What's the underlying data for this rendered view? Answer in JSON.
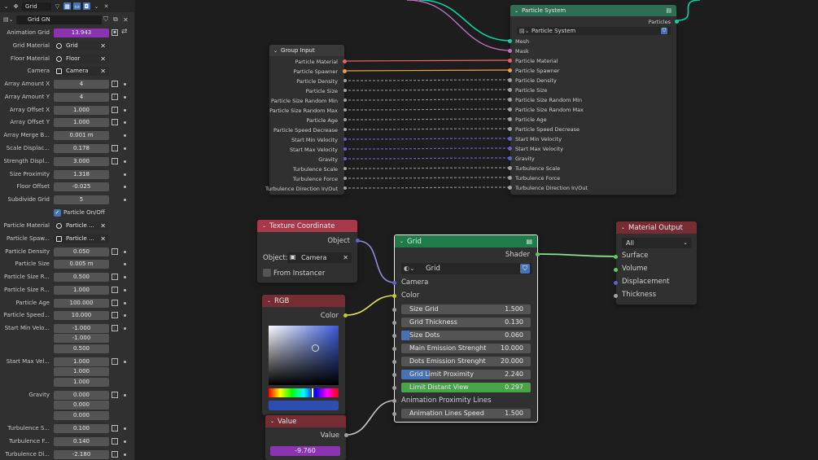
{
  "header": {
    "title": "Grid"
  },
  "modifier": {
    "name": "Grid GN"
  },
  "properties": [
    {
      "label": "Animation Grid",
      "value": "13.943",
      "kind": "purple",
      "key": "anim"
    },
    {
      "label": "Grid Material",
      "value": "Grid",
      "kind": "mat"
    },
    {
      "label": "Floor Material",
      "value": "Floor",
      "kind": "mat"
    },
    {
      "label": "Camera",
      "value": "Camera",
      "kind": "obj"
    },
    {
      "label": "Array Amount X",
      "value": "4"
    },
    {
      "label": "Array Amount Y",
      "value": "4"
    },
    {
      "label": "Array Offset X",
      "value": "1.000"
    },
    {
      "label": "Array Offset Y",
      "value": "1.000"
    },
    {
      "label": "Array Merge B...",
      "value": "0.001 m",
      "nokf": true
    },
    {
      "label": "Scale Displac...",
      "value": "0.178"
    },
    {
      "label": "Strength Displ...",
      "value": "3.000"
    },
    {
      "label": "Size Proximity",
      "value": "1.318",
      "nokf": true
    },
    {
      "label": "Floor Offset",
      "value": "-0.025",
      "nokf": true
    },
    {
      "label": "Subdivide Grid",
      "value": "5",
      "nokf": true
    },
    {
      "label": "",
      "value": "Particle On/Off",
      "kind": "check"
    },
    {
      "label": "Particle Material",
      "value": "Particle ...",
      "kind": "mat"
    },
    {
      "label": "Particle Spaw...",
      "value": "Particle ...",
      "kind": "obj"
    },
    {
      "label": "Particle Density",
      "value": "0.050"
    },
    {
      "label": "Particle Size",
      "value": "0.005 m",
      "nokf": true
    },
    {
      "label": "Particle Size R...",
      "value": "0.500"
    },
    {
      "label": "Particle Size R...",
      "value": "1.000"
    },
    {
      "label": "Particle Age",
      "value": "100.000"
    },
    {
      "label": "Particle Speed...",
      "value": "10.000"
    },
    {
      "label": "Start Min Velo...",
      "value": "-1.000"
    },
    {
      "label": "",
      "value": "-1.000",
      "nokf": true,
      "nodot": true
    },
    {
      "label": "",
      "value": "0.500",
      "nokf": true,
      "nodot": true
    },
    {
      "label": "Start Max Vel...",
      "value": "1.000"
    },
    {
      "label": "",
      "value": "1.000",
      "nokf": true,
      "nodot": true
    },
    {
      "label": "",
      "value": "1.000",
      "nokf": true,
      "nodot": true
    },
    {
      "label": "Gravity",
      "value": "0.000"
    },
    {
      "label": "",
      "value": "0.000",
      "nokf": true,
      "nodot": true
    },
    {
      "label": "",
      "value": "0.000",
      "nokf": true,
      "nodot": true
    },
    {
      "label": "Turbulence S...",
      "value": "0.100"
    },
    {
      "label": "Turbulence F...",
      "value": "0.140"
    },
    {
      "label": "Turbulence Di...",
      "value": "-2.180"
    }
  ],
  "group_input": {
    "title": "Group Input",
    "sockets": [
      "Particle Material",
      "Particle Spawner",
      "Particle Density",
      "Particle Size",
      "Particle Size Random Min",
      "Particle Size Random Max",
      "Particle Age",
      "Particle Speed Decrease",
      "Start Min Velocity",
      "Start Max Velocity",
      "Gravity",
      "Turbulence Scale",
      "Turbulence Force",
      "Turbulence Direction In/Out"
    ]
  },
  "particle_system": {
    "title": "Particle System",
    "output": "Particles",
    "selector": "Particle System",
    "inputs": [
      "Mesh",
      "Mask",
      "Particle Material",
      "Particle Spawner",
      "Particle Density",
      "Particle Size",
      "Particle Size Random Min",
      "Particle Size Random Max",
      "Particle Age",
      "Particle Speed Decrease",
      "Start Min Velocity",
      "Start Max Velocity",
      "Gravity",
      "Turbulence Scale",
      "Turbulence Force",
      "Turbulence Direction In/Out"
    ]
  },
  "texture_coordinate": {
    "title": "Texture Coordinate",
    "output": "Object",
    "object_label": "Object:",
    "object_value": "Camera",
    "from_instancer": "From Instancer"
  },
  "rgb": {
    "title": "RGB",
    "output": "Color"
  },
  "value_node": {
    "title": "Value",
    "output": "Value",
    "value": "-9.760"
  },
  "grid_node": {
    "title": "Grid",
    "output": "Shader",
    "selector": "Grid",
    "camera": "Camera",
    "color": "Color",
    "sliders": [
      {
        "label": "Size Grid",
        "value": "1.500",
        "fill": 0
      },
      {
        "label": "Grid Thickness",
        "value": "0.130",
        "fill": 0
      },
      {
        "label": "Size Dots",
        "value": "0.060",
        "fill": 0.06
      },
      {
        "label": "Main Emission Strenght",
        "value": "10.000",
        "fill": 0
      },
      {
        "label": "Dots Emission Strenght",
        "value": "20.000",
        "fill": 0
      },
      {
        "label": "Grid Limit Proximity",
        "value": "2.240",
        "fill": 0.22
      },
      {
        "label": "Limit Distant View",
        "value": "0.297",
        "fill": 1.0
      }
    ],
    "animation_label": "Animation Proximity Lines",
    "animation_speed": {
      "label": "Animation Lines Speed",
      "value": "1.500"
    }
  },
  "material_output": {
    "title": "Material Output",
    "target": "All",
    "inputs": [
      "Surface",
      "Volume",
      "Displacement",
      "Thickness"
    ]
  },
  "colors": {
    "purple": "#8b33b0",
    "header_tex": "#a8394a",
    "header_grid": "#1f7c4a",
    "header_out": "#752c33",
    "header_geo": "#2d6e55",
    "green_fill": "#47a447",
    "blue_fill": "#4772b3"
  }
}
